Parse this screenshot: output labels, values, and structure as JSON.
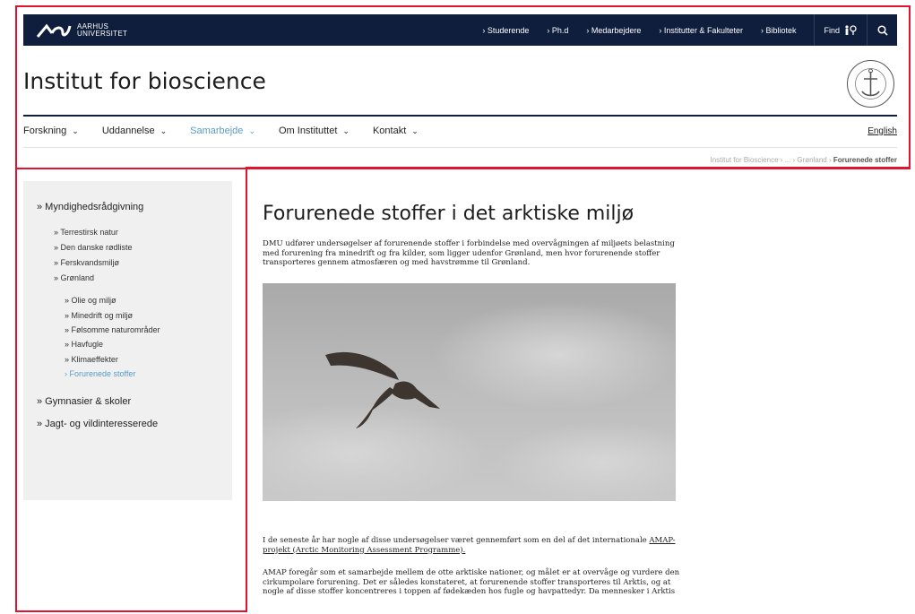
{
  "header": {
    "logo_line1": "AARHUS",
    "logo_line2": "UNIVERSITET",
    "top_links": [
      "› Studerende",
      "› Ph.d",
      "› Medarbejdere",
      "› Institutter & Fakulteter",
      "› Bibliotek"
    ],
    "find_label": "Find",
    "site_title": "Institut for bioscience",
    "seal_text": "SOLIDUM PETIT IN PROFUNDIS · UNIVERSITAS ARHUSIENSIS"
  },
  "nav": {
    "items": [
      "Forskning",
      "Uddannelse",
      "Samarbejde",
      "Om Instituttet",
      "Kontakt"
    ],
    "active_index": 2,
    "english_label": "English"
  },
  "breadcrumb": {
    "trail": "Institut for Bioscience  ›  ...  ›  Grønland  ›",
    "current": "Forurenede stoffer"
  },
  "sidebar": {
    "section1": "» Myndighedsrådgivning",
    "level1": [
      "» Terrestirsk natur",
      "» Den danske rødliste",
      "» Ferskvandsmiljø",
      "» Grønland"
    ],
    "level2": [
      "» Olie og miljø",
      "» Minedrift og miljø",
      "» Følsomme naturområder",
      "» Havfugle",
      "» Klimaeffekter",
      "› Forurenede stoffer"
    ],
    "section2": "» Gymnasier & skoler",
    "section3": "» Jagt- og vildinteresserede"
  },
  "article": {
    "heading": "Forurenede stoffer i det arktiske miljø",
    "intro": "DMU udfører undersøgelser af forurenende stoffer i forbindelse med overvågningen af miljøets belastning med forurening fra minedrift og fra kilder, som ligger udenfor Grønland, men hvor forurenende stoffer transporteres gennem atmosfæren og med havstrømme til Grønland.",
    "para2_text": "I de seneste år har nogle af disse undersøgelser været gennemført som en del af det internationale",
    "para2_link": "AMAP-projekt (Arctic Monitoring Assessment Programme).",
    "para3": "AMAP foregår som et samarbejde mellem de otte arktiske nationer, og målet er at overvåge og vurdere den cirkumpolare forurening. Det er således konstateret, at forurenende stoffer transporteres til Arktis, og at nogle af disse stoffer koncentreres i toppen af fødekæden hos fugle og havpattedyr. Da mennesker i Arktis"
  },
  "colors": {
    "topbar": "#0f1e3c",
    "accent": "#5a9cc7",
    "highlight_box": "#e0142e"
  }
}
